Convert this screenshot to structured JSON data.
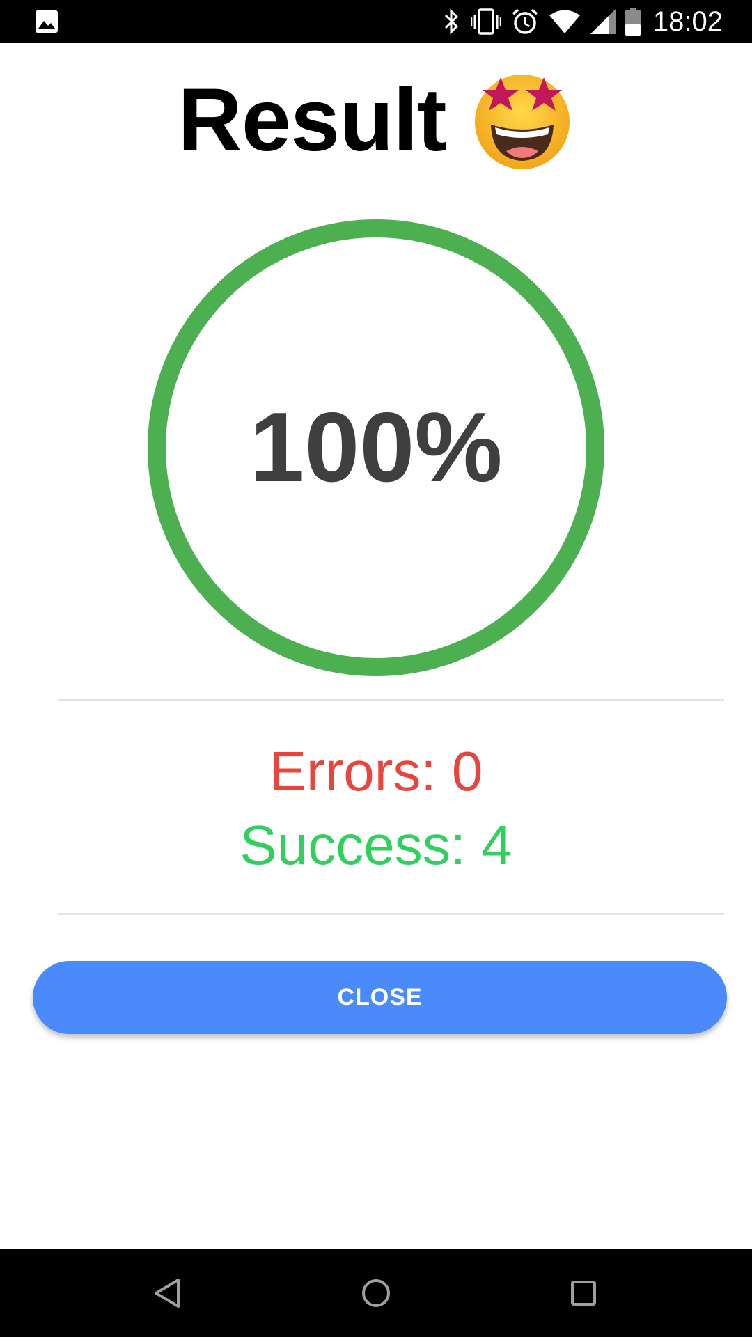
{
  "status_bar": {
    "time": "18:02",
    "icons": [
      "gallery-icon",
      "bluetooth-icon",
      "vibrate-icon",
      "alarm-icon",
      "wifi-icon",
      "signal-icon",
      "battery-icon"
    ]
  },
  "header": {
    "title": "Result",
    "emoji_icon": "star-struck-emoji-icon"
  },
  "result": {
    "percent_label": "100%",
    "progress": 1.0,
    "ring_color": "#4caf50",
    "errors_label": "Errors: 0",
    "errors_color": "#e8453c",
    "success_label": "Success: 4",
    "success_color": "#2fd05e"
  },
  "actions": {
    "close_label": "CLOSE",
    "close_color": "#4a8afa"
  },
  "nav_bar": {
    "icons": [
      "back-icon",
      "home-icon",
      "recents-icon"
    ]
  }
}
